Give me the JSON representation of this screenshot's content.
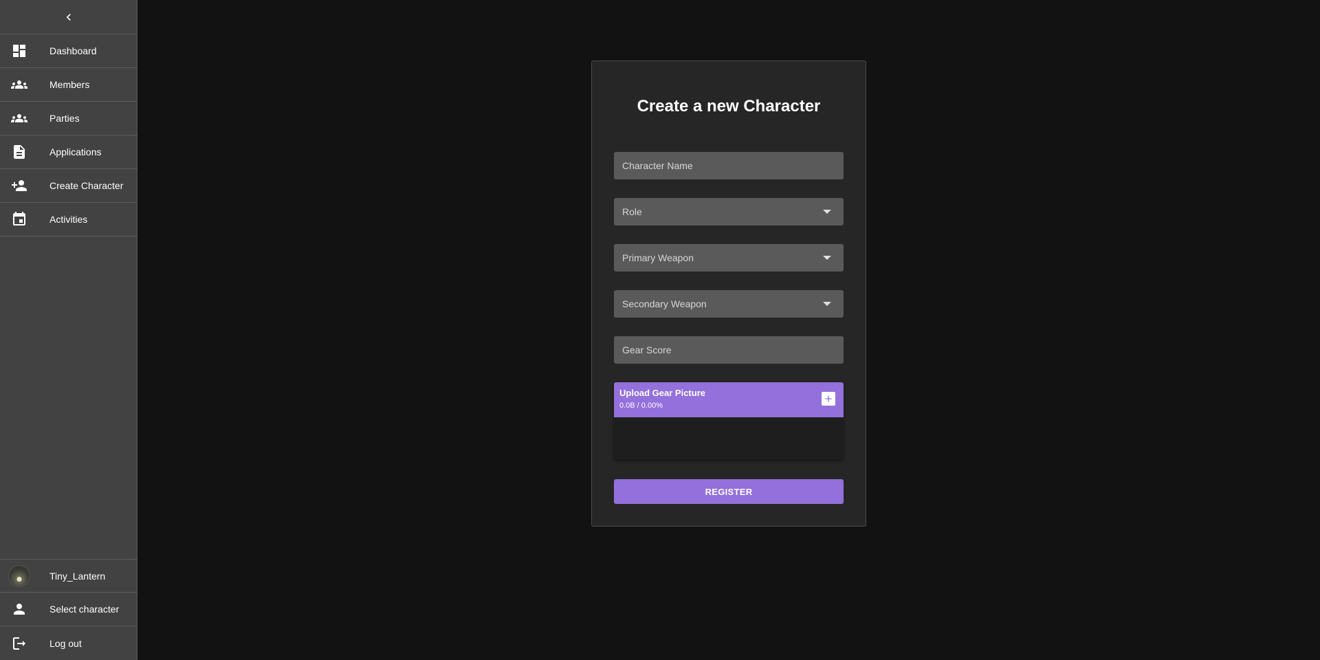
{
  "sidebar": {
    "collapse_icon": "chevron-left-icon",
    "items": [
      {
        "label": "Dashboard",
        "icon": "dashboard-icon"
      },
      {
        "label": "Members",
        "icon": "group-icon"
      },
      {
        "label": "Parties",
        "icon": "groups-icon"
      },
      {
        "label": "Applications",
        "icon": "document-icon"
      },
      {
        "label": "Create Character",
        "icon": "person-add-icon"
      },
      {
        "label": "Activities",
        "icon": "calendar-icon"
      }
    ],
    "bottom": {
      "user": {
        "label": "Tiny_Lantern",
        "icon": "avatar"
      },
      "select_character": {
        "label": "Select character",
        "icon": "person-icon"
      },
      "logout": {
        "label": "Log out",
        "icon": "logout-icon"
      }
    }
  },
  "form": {
    "title": "Create a new Character",
    "character_name_placeholder": "Character Name",
    "role_placeholder": "Role",
    "primary_weapon_placeholder": "Primary Weapon",
    "secondary_weapon_placeholder": "Secondary Weapon",
    "gear_score_placeholder": "Gear Score",
    "upload": {
      "title": "Upload Gear Picture",
      "status": "0.0B / 0.00%",
      "add_icon": "plus-icon"
    },
    "register_label": "REGISTER"
  },
  "colors": {
    "accent": "#9370db",
    "background": "#121212",
    "sidebar": "#424242",
    "card": "#262626",
    "field": "#5a5a5a"
  }
}
